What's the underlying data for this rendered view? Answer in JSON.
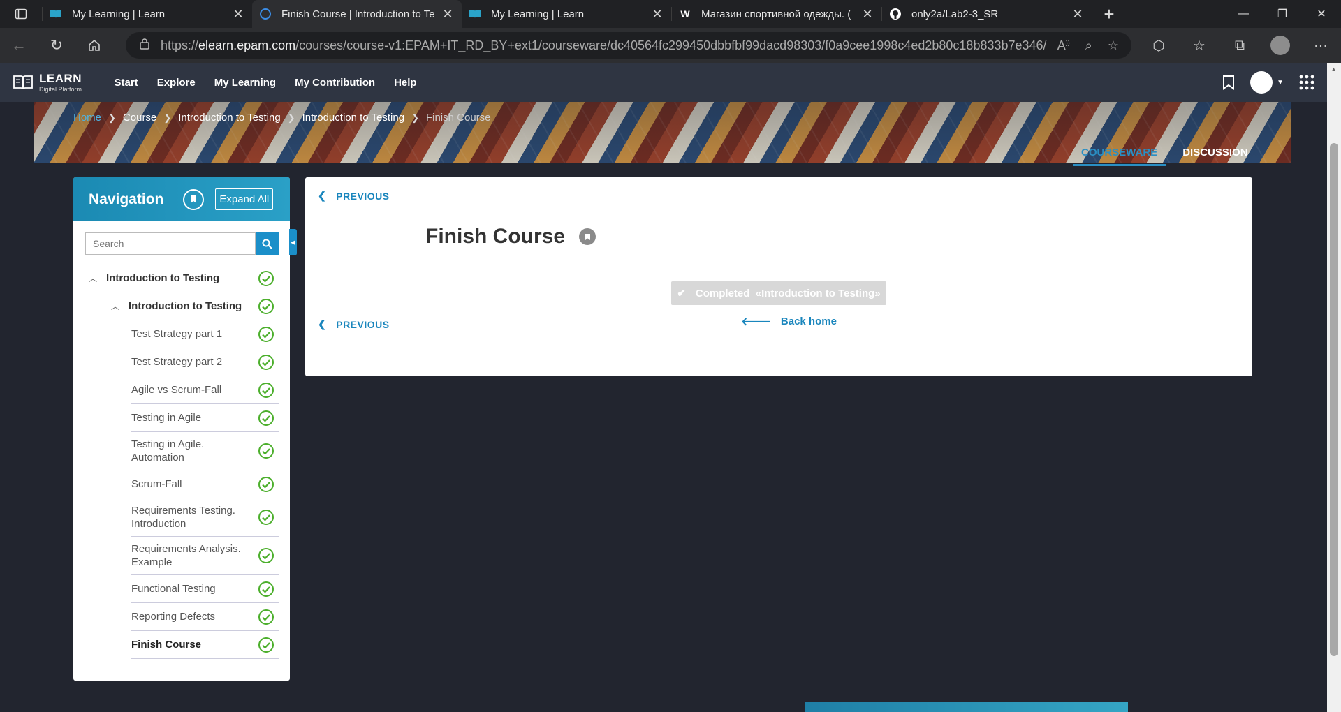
{
  "browser": {
    "tabs": [
      {
        "title": "My Learning | Learn",
        "icon": "learn-book-icon",
        "active": false
      },
      {
        "title": "Finish Course | Introduction to Te",
        "icon": "loading-icon",
        "active": true
      },
      {
        "title": "My Learning | Learn",
        "icon": "learn-book-icon",
        "active": false
      },
      {
        "title": "Магазин спортивной одежды. (",
        "icon": "w-brand-icon",
        "active": false
      },
      {
        "title": "only2a/Lab2-3_SR",
        "icon": "github-icon",
        "active": false
      }
    ],
    "url_prefix": "https://",
    "url_host": "elearn.epam.com",
    "url_path": "/courses/course-v1:EPAM+IT_RD_BY+ext1/courseware/dc40564fc299450dbbfbf99dacd98303/f0a9cee1998c4ed2b80c18b833b7e346/"
  },
  "site": {
    "logo_title": "LEARN",
    "logo_subtitle": "Digital Platform",
    "nav": [
      "Start",
      "Explore",
      "My Learning",
      "My Contribution",
      "Help"
    ]
  },
  "breadcrumbs": [
    "Home",
    "Course",
    "Introduction to Testing",
    "Introduction to Testing",
    "Finish Course"
  ],
  "course_tabs": {
    "courseware": "COURSEWARE",
    "discussion": "DISCUSSION"
  },
  "navigation": {
    "title": "Navigation",
    "expand_all": "Expand All",
    "search_placeholder": "Search",
    "section": "Introduction to Testing",
    "subsection": "Introduction to Testing",
    "units": [
      "Test Strategy part 1",
      "Test Strategy part 2",
      "Agile vs Scrum-Fall",
      "Testing in Agile",
      "Testing in Agile. Automation",
      "Scrum-Fall",
      "Requirements Testing. Introduction",
      "Requirements Analysis. Example",
      "Functional Testing",
      "Reporting Defects",
      "Finish Course"
    ],
    "current_unit": "Finish Course"
  },
  "content": {
    "previous_label": "PREVIOUS",
    "title": "Finish Course",
    "completed_label": "Completed  «Introduction to Testing»",
    "back_home": "Back home"
  },
  "colors": {
    "accent": "#1a86bd",
    "check_green": "#4caf2c",
    "header_bg": "#2f3542",
    "page_bg": "#22252f"
  }
}
